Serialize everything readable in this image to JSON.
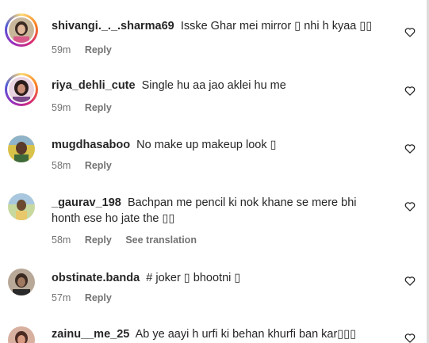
{
  "comments": [
    {
      "username": "shivangi._._.sharma69",
      "text": "Isske Ghar mei mirror ▯ nhi h kyaa ▯▯",
      "time": "59m",
      "reply_label": "Reply"
    },
    {
      "username": "riya_dehli_cute",
      "text": "Single hu aa jao aklei hu me",
      "time": "59m",
      "reply_label": "Reply"
    },
    {
      "username": "mugdhasaboo",
      "text": "No make up makeup look ▯",
      "time": "58m",
      "reply_label": "Reply"
    },
    {
      "username": "_gaurav_198",
      "text": "Bachpan me pencil ki nok khane se mere bhi honth ese ho jate the ▯▯",
      "time": "58m",
      "reply_label": "Reply",
      "translation_label": "See translation"
    },
    {
      "username": "obstinate.banda",
      "text": "# joker ▯ bhootni ▯",
      "time": "57m",
      "reply_label": "Reply"
    },
    {
      "username": "zainu__me_25",
      "text": "Ab ye aayi h urfi ki behan khurfi ban kar▯▯▯"
    }
  ],
  "icons": {
    "like": "heart-outline-icon",
    "story_ring": "story-ring-gradient"
  },
  "colors": {
    "text": "#262626",
    "meta": "#737373",
    "background": "#ffffff"
  }
}
